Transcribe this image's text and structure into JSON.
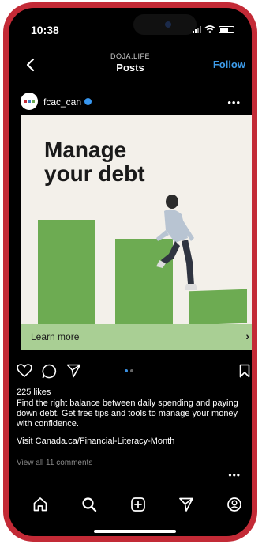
{
  "status": {
    "time": "10:38"
  },
  "header": {
    "brand": "DOJA.LIFE",
    "title": "Posts",
    "follow_label": "Follow"
  },
  "post": {
    "username": "fcac_can",
    "headline_line1": "Manage",
    "headline_line2": "your debt",
    "cta_label": "Learn more",
    "likes": "225 likes",
    "caption": "Find the right balance between daily spending and paying down debt. Get free tips and tools to manage your money with confidence.",
    "link_text": "Visit Canada.ca/Financial-Literacy-Month",
    "comments_link": "View all 11 comments"
  },
  "colors": {
    "accent": "#3d9be9",
    "phone_frame": "#c32a36",
    "bar_green": "#6dab52",
    "cta_green": "#a9cf94"
  },
  "icons": [
    "back-arrow-icon",
    "heart-icon",
    "comment-icon",
    "share-icon",
    "bookmark-icon",
    "home-icon",
    "search-icon",
    "create-icon",
    "messages-icon",
    "profile-icon",
    "more-icon"
  ]
}
